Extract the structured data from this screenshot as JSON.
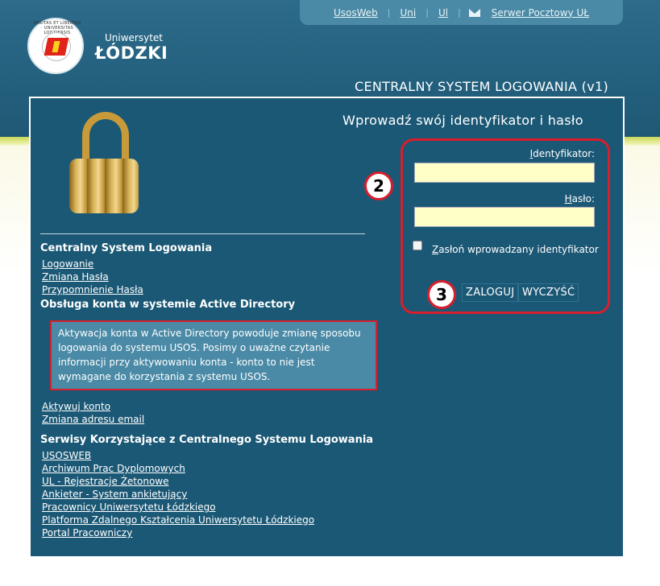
{
  "topnav": {
    "links": [
      "UsosWeb",
      "Uni",
      "Ul",
      "Serwer Pocztowy UŁ"
    ],
    "mail_icon": "envelope-icon"
  },
  "logo": {
    "seal_text": "VERITAS ET LIBERTAS · UNIVERSITAS LODZIENSIS",
    "name_small": "Uniwersytet",
    "name_big": "ŁÓDZKI"
  },
  "system_title": "CENTRALNY SYSTEM LOGOWANIA (v1)",
  "login": {
    "subtitle": "Wprowadź swój identyfikator i hasło",
    "id_label_first": "I",
    "id_label_rest": "dentyfikator:",
    "id_value": "",
    "pass_label_first": "H",
    "pass_label_rest": "asło:",
    "pass_value": "",
    "mask_label_first": "Z",
    "mask_label_rest": "asłoń wprowadzany identyfikator",
    "mask_checked": false,
    "login_button": "ZALOGUJ",
    "clear_button": "WYCZYŚĆ",
    "badge_2": "2",
    "badge_3": "3"
  },
  "sections": {
    "cas_heading": "Centralny System Logowania",
    "cas_links": [
      "Logowanie",
      "Zmiana Hasła",
      "Przypomnienie Hasła"
    ],
    "ad_heading": "Obsługa konta w systemie Active Directory",
    "ad_notice": "Aktywacja konta w Active Directory powoduje zmianę sposobu logowania do systemu USOS. Posimy o uważne czytanie informacji przy aktywowaniu konta - konto to nie jest wymagane do korzystania z systemu USOS.",
    "ad_links": [
      "Aktywuj konto",
      "Zmiana adresu email"
    ],
    "services_heading": "Serwisy Korzystające z Centralnego Systemu Logowania",
    "services_links": [
      "USOSWEB",
      "Archiwum Prac Dyplomowych",
      "UL - Rejestracje Żetonowe",
      "Ankieter - System ankietujący",
      "Pracownicy Uniwersytetu Łódzkiego",
      "Platforma Zdalnego Kształcenia Uniwersytetu Łódzkiego",
      "Portal Pracowniczy"
    ]
  },
  "colors": {
    "header_bg": "#23607e",
    "panel_bg": "#1b5875",
    "nav_bg": "#4a8aa6",
    "input_bg": "#ffffc8",
    "highlight_red": "#d81e2c"
  }
}
